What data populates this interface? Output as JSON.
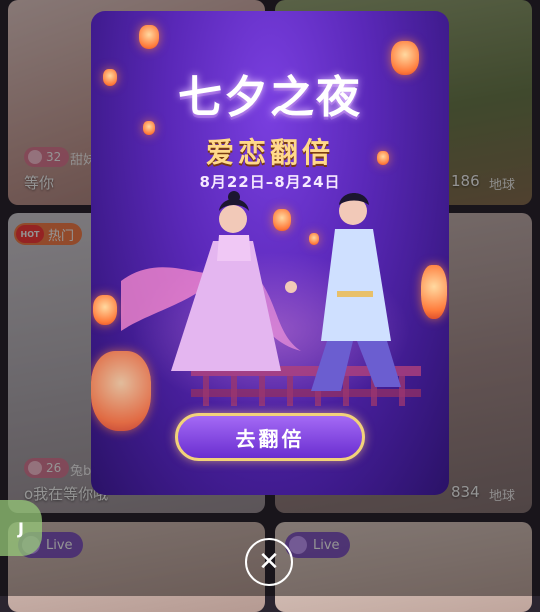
{
  "feed": {
    "cards": [
      {
        "id": "c1",
        "level": "32",
        "name": "甜妹",
        "caption": "等你",
        "bg": "#d9b5b5"
      },
      {
        "id": "c2",
        "count": "186",
        "location": "地球",
        "bg": "#7d8f5a"
      },
      {
        "id": "c3",
        "hot_label": "热门",
        "hot_icon_text": "HOT",
        "level": "26",
        "name": "兔b",
        "caption": "o我在等你哦",
        "bg": "#c7c1c9"
      },
      {
        "id": "c4",
        "count": "834",
        "location": "地球",
        "bg": "#b7a9aa"
      },
      {
        "id": "c5",
        "live_label": "Live",
        "bg": "#cdb8b0"
      },
      {
        "id": "c6",
        "live_label": "Live",
        "bg": "#d8c6c0"
      }
    ]
  },
  "popup": {
    "title": "七夕之夜",
    "subtitle": "爱恋翻倍",
    "dates": "8月22日–8月24日",
    "cta_label": "去翻倍",
    "close_symbol": "✕"
  },
  "float_icon_label": "J",
  "colors": {
    "cta_border": "#f2d27a",
    "popup_bg": "#5a28b8",
    "subtitle": "#ffd98a"
  }
}
